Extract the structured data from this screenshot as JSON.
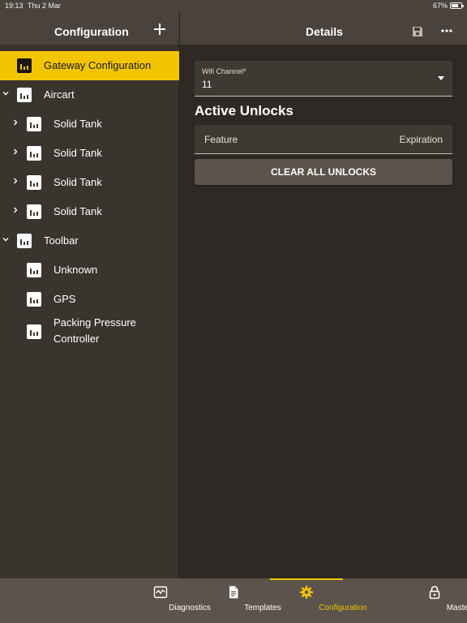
{
  "status_bar": {
    "time": "19:13",
    "date": "Thu 2 Mar",
    "battery": "67%"
  },
  "left_header": {
    "title": "Configuration"
  },
  "right_header": {
    "title": "Details"
  },
  "tree": {
    "items": [
      {
        "label": "Gateway Configuration"
      },
      {
        "label": "Aircart"
      },
      {
        "label": "Solid Tank"
      },
      {
        "label": "Solid Tank"
      },
      {
        "label": "Solid Tank"
      },
      {
        "label": "Solid Tank"
      },
      {
        "label": "Toolbar"
      },
      {
        "label": "Unknown"
      },
      {
        "label": "GPS"
      },
      {
        "label": "Packing Pressure Controller"
      }
    ]
  },
  "details": {
    "wifi_channel": {
      "label": "Wifi Channel*",
      "value": "11"
    },
    "active_unlocks": {
      "title": "Active Unlocks",
      "columns": [
        "Feature",
        "Expiration"
      ]
    },
    "clear_button": "CLEAR ALL UNLOCKS"
  },
  "bottom_nav": {
    "items": [
      {
        "label": "Diagnostics",
        "icon": "diagnostics-icon"
      },
      {
        "label": "Templates",
        "icon": "document-icon"
      },
      {
        "label": "Configuration",
        "icon": "gear-icon"
      },
      {
        "label": "Master",
        "icon": "lock-icon"
      }
    ],
    "active": "Configuration"
  },
  "colors": {
    "accent": "#f2c500",
    "header_bg": "#4a433d",
    "sidebar_bg": "#3a342e",
    "content_bg": "#2e2925",
    "nav_bg": "#5b534c"
  }
}
